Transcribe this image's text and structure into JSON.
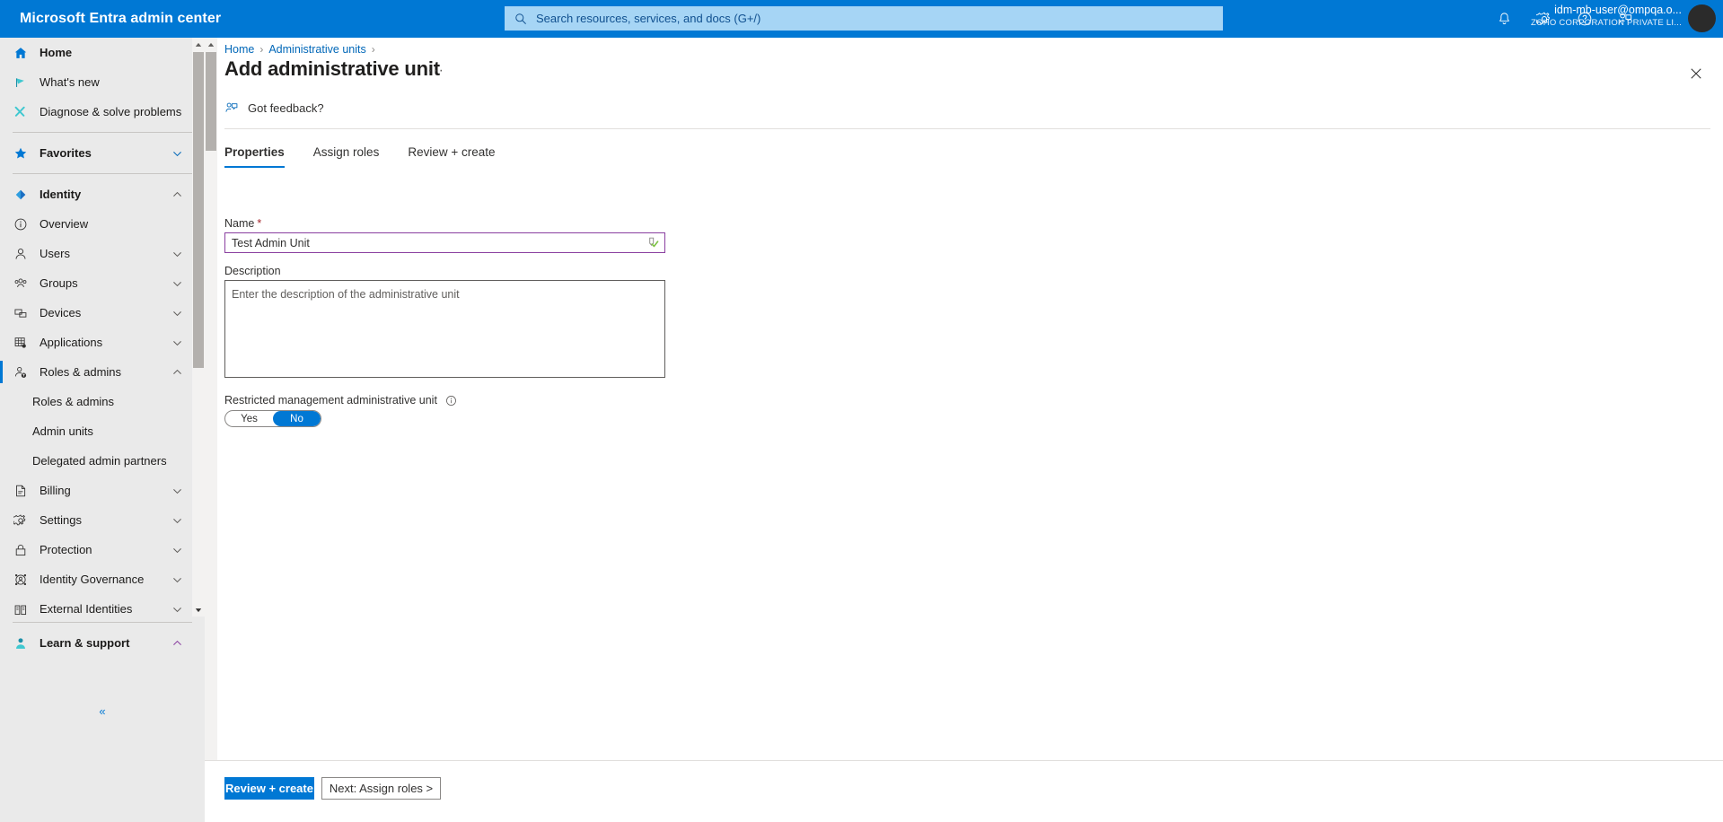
{
  "header": {
    "brand": "Microsoft Entra admin center",
    "search": {
      "placeholder": "Search resources, services, and docs (G+/)",
      "value": "",
      "icon": "search-icon"
    },
    "icons": [
      {
        "name": "notifications-bell-icon",
        "label": "Notifications"
      },
      {
        "name": "settings-gear-icon",
        "label": "Settings"
      },
      {
        "name": "help-question-icon",
        "label": "Help"
      },
      {
        "name": "feedback-icon",
        "label": "Feedback"
      }
    ],
    "account": {
      "user": "idm-mb-user@ompqa.o...",
      "org": "ZOHO CORPORATION PRIVATE LI...",
      "avatar": "avatar"
    },
    "background_color": "#0078d4"
  },
  "sidebar": {
    "items": [
      {
        "label": "Home",
        "icon": "home-icon",
        "bold": true,
        "chevron": "",
        "type": "item"
      },
      {
        "label": "What's new",
        "icon": "whats-new-megaphone-icon",
        "bold": false,
        "chevron": "",
        "type": "item"
      },
      {
        "label": "Diagnose & solve problems",
        "icon": "diagnose-tools-icon",
        "bold": false,
        "chevron": "",
        "type": "item"
      },
      {
        "type": "divider"
      },
      {
        "label": "Favorites",
        "icon": "star-icon",
        "bold": true,
        "chevron": "down",
        "type": "item"
      },
      {
        "type": "divider"
      },
      {
        "label": "Identity",
        "icon": "identity-diamond-icon",
        "bold": true,
        "chevron": "up",
        "type": "item"
      },
      {
        "label": "Overview",
        "icon": "info-circle-icon",
        "bold": false,
        "chevron": "",
        "type": "item"
      },
      {
        "label": "Users",
        "icon": "user-icon",
        "bold": false,
        "chevron": "down",
        "type": "item"
      },
      {
        "label": "Groups",
        "icon": "groups-icon",
        "bold": false,
        "chevron": "down",
        "type": "item"
      },
      {
        "label": "Devices",
        "icon": "devices-icon",
        "bold": false,
        "chevron": "down",
        "type": "item"
      },
      {
        "label": "Applications",
        "icon": "applications-grid-icon",
        "bold": false,
        "chevron": "down",
        "type": "item"
      },
      {
        "label": "Roles & admins",
        "icon": "roles-admins-icon",
        "bold": false,
        "chevron": "up",
        "type": "item",
        "selected": true
      },
      {
        "label": "Roles & admins",
        "type": "subitem"
      },
      {
        "label": "Admin units",
        "type": "subitem"
      },
      {
        "label": "Delegated admin partners",
        "type": "subitem"
      },
      {
        "label": "Billing",
        "icon": "billing-document-icon",
        "bold": false,
        "chevron": "down",
        "type": "item"
      },
      {
        "label": "Settings",
        "icon": "settings-gear-icon",
        "bold": false,
        "chevron": "down",
        "type": "item"
      },
      {
        "label": "Protection",
        "icon": "protection-lock-icon",
        "bold": false,
        "chevron": "down",
        "type": "item"
      },
      {
        "label": "Identity Governance",
        "icon": "identity-governance-icon",
        "bold": false,
        "chevron": "down",
        "type": "item"
      },
      {
        "label": "External Identities",
        "icon": "external-identities-icon",
        "bold": false,
        "chevron": "down",
        "type": "item"
      }
    ],
    "bottom": {
      "label": "Learn & support",
      "icon": "learn-support-icon",
      "chevron": "up"
    },
    "collapse_label": "«"
  },
  "blade": {
    "breadcrumb": [
      {
        "label": "Home",
        "link": true
      },
      {
        "label": "Administrative units",
        "link": true
      }
    ],
    "breadcrumb_separator": "›",
    "title": "Add administrative unit",
    "title_menu": "···",
    "close_icon": "close-icon",
    "feedback": {
      "label": "Got feedback?",
      "icon": "feedback-icon"
    },
    "tabs": [
      {
        "label": "Properties",
        "active": true
      },
      {
        "label": "Assign roles",
        "active": false
      },
      {
        "label": "Review + create",
        "active": false
      }
    ],
    "form": {
      "name": {
        "label": "Name",
        "required_marker": "*",
        "value": "Test Admin Unit",
        "placeholder": "",
        "border_color": "#8a3fa0",
        "validation_icon": "validation-check-icon"
      },
      "description": {
        "label": "Description",
        "value": "",
        "placeholder": "Enter the description of the administrative unit"
      },
      "restricted": {
        "label": "Restricted management administrative unit",
        "info_icon": "info-circle-icon",
        "options": [
          {
            "label": "Yes",
            "selected": false
          },
          {
            "label": "No",
            "selected": true
          }
        ],
        "selected_color": "#0078d4"
      }
    }
  },
  "footer": {
    "primary_button": "Review + create",
    "secondary_button": "Next: Assign roles >"
  }
}
